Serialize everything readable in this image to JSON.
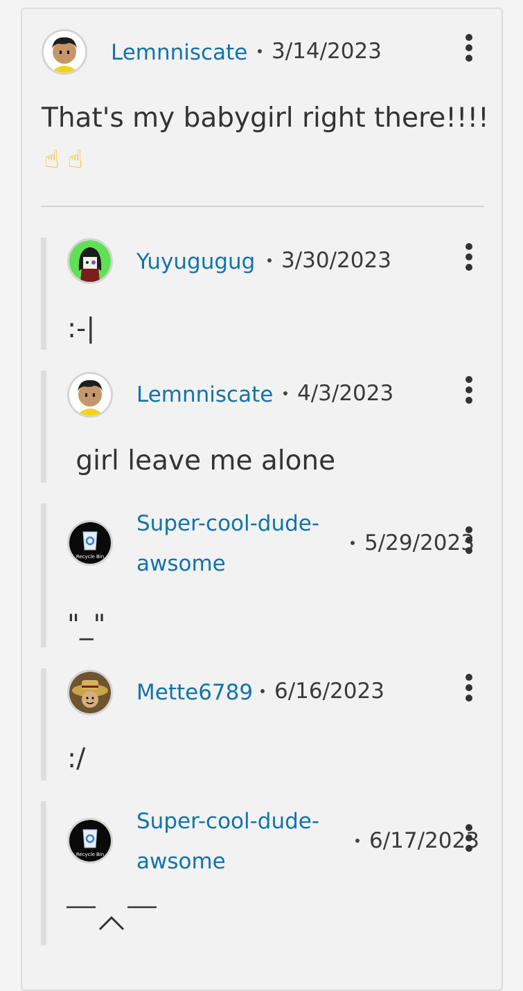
{
  "thread": {
    "root": {
      "username": "Lemnniscate",
      "date": "3/14/2023",
      "text": "That's my babygirl right there!!!!",
      "emoji": [
        "☝",
        "☝"
      ]
    },
    "replies": [
      {
        "username": "Yuyugugug",
        "date": "3/30/2023",
        "text": ":-|"
      },
      {
        "username": "Lemnniscate",
        "date": "4/3/2023",
        "text": " girl leave me alone"
      },
      {
        "username_line1": "Super-cool-dude-",
        "username_line2": "awsome",
        "date": "5/29/2023",
        "text": "\"_\"",
        "avatar_label": "Recycle Bin"
      },
      {
        "username": "Mette6789",
        "date": "6/16/2023",
        "text": ":/"
      },
      {
        "username_line1": "Super-cool-dude-",
        "username_line2": "awsome",
        "date": "6/17/2023",
        "text": "",
        "avatar_label": "Recycle Bin"
      }
    ]
  },
  "colors": {
    "link": "#1273a9",
    "text": "#333333",
    "reply_bar": "#dedede"
  }
}
